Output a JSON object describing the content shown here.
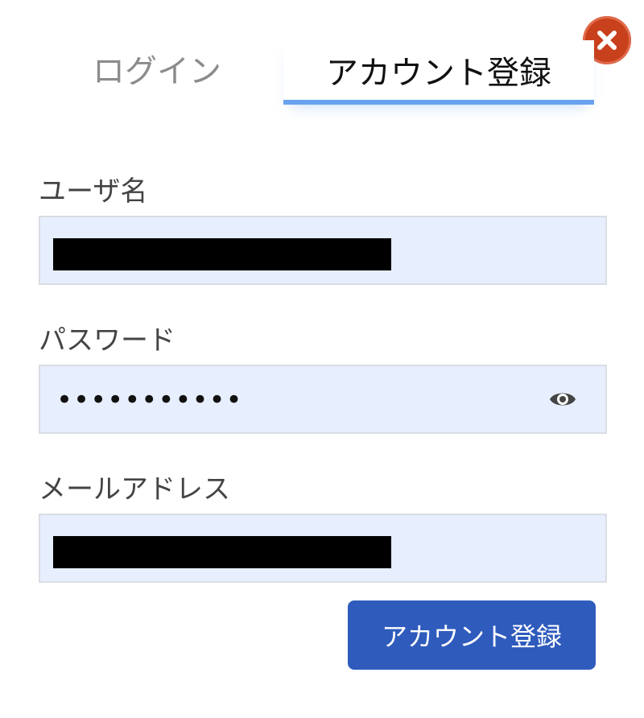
{
  "tabs": {
    "login_label": "ログイン",
    "register_label": "アカウント登録",
    "active": "register"
  },
  "close_button": {
    "icon": "close-icon"
  },
  "form": {
    "username": {
      "label": "ユーザ名",
      "value_redacted": true
    },
    "password": {
      "label": "パスワード",
      "value": "•••••••••••",
      "toggle_icon": "eye-icon"
    },
    "email": {
      "label": "メールアドレス",
      "value_redacted": true
    },
    "submit_label": "アカウント登録"
  },
  "colors": {
    "accent_underline": "#6aa2f0",
    "submit_button": "#2f5bbd",
    "close_button": "#c9401c",
    "input_background": "#e7eefd"
  }
}
